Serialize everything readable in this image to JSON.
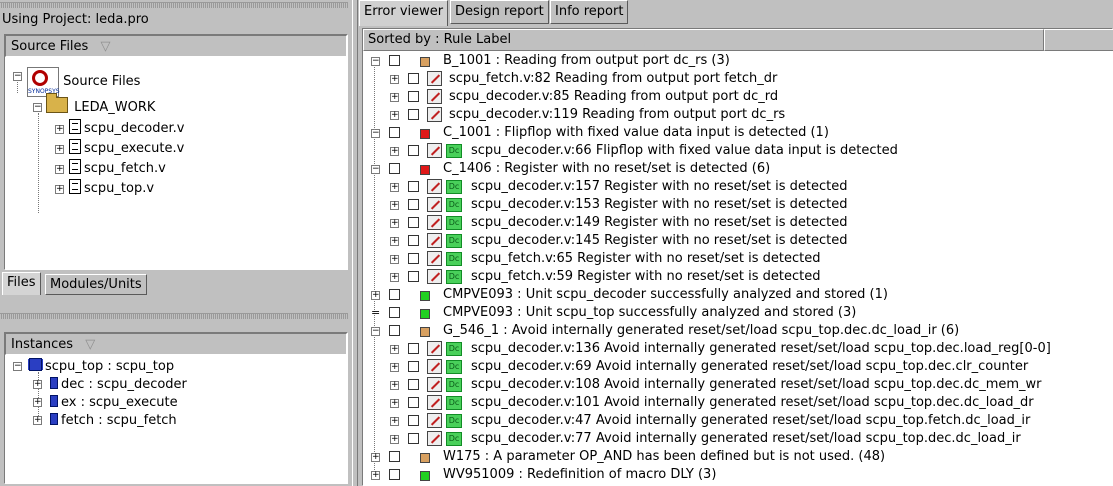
{
  "left": {
    "project_label": "Using Project: leda.pro",
    "source_panel": {
      "header": "Source Files",
      "root": "Source Files",
      "folder": "LEDA_WORK",
      "files": [
        "scpu_decoder.v",
        "scpu_execute.v",
        "scpu_fetch.v",
        "scpu_top.v"
      ]
    },
    "tabs": {
      "files": "Files",
      "modules": "Modules/Units"
    },
    "instances_panel": {
      "header": "Instances",
      "root": "scpu_top : scpu_top",
      "children": [
        "dec : scpu_decoder",
        "ex : scpu_execute",
        "fetch : scpu_fetch"
      ]
    }
  },
  "right": {
    "tabs": [
      "Error viewer",
      "Design report",
      "Info report"
    ],
    "sort_label": "Sorted by : Rule Label",
    "colors": {
      "orange": "#d8a060",
      "red": "#e01818",
      "green": "#20d020"
    },
    "rows": [
      {
        "level": 0,
        "sev": "orange",
        "text": "B_1001 : Reading from output port dc_rs (3)",
        "exp": "-"
      },
      {
        "level": 1,
        "icon": "pencil",
        "text": "scpu_fetch.v:82 Reading from output port fetch_dr",
        "exp": "+"
      },
      {
        "level": 1,
        "icon": "pencil",
        "text": "scpu_decoder.v:85 Reading from output port dc_rd",
        "exp": "+"
      },
      {
        "level": 1,
        "icon": "pencil",
        "text": "scpu_decoder.v:119 Reading from output port dc_rs",
        "exp": "+"
      },
      {
        "level": 0,
        "sev": "red",
        "text": "C_1001 : Flipflop with fixed value data input is detected (1)",
        "exp": "-"
      },
      {
        "level": 1,
        "icon": "pencil-dc",
        "text": "scpu_decoder.v:66 Flipflop with fixed value data input is detected",
        "exp": "+"
      },
      {
        "level": 0,
        "sev": "red",
        "text": "C_1406 : Register with no reset/set is detected (6)",
        "exp": "-"
      },
      {
        "level": 1,
        "icon": "pencil-dc",
        "text": "scpu_decoder.v:157 Register with no reset/set is detected",
        "exp": "+"
      },
      {
        "level": 1,
        "icon": "pencil-dc",
        "text": "scpu_decoder.v:153 Register with no reset/set is detected",
        "exp": "+"
      },
      {
        "level": 1,
        "icon": "pencil-dc",
        "text": "scpu_decoder.v:149 Register with no reset/set is detected",
        "exp": "+"
      },
      {
        "level": 1,
        "icon": "pencil-dc",
        "text": "scpu_decoder.v:145 Register with no reset/set is detected",
        "exp": "+"
      },
      {
        "level": 1,
        "icon": "pencil-dc",
        "text": "scpu_fetch.v:65 Register with no reset/set is detected",
        "exp": "+"
      },
      {
        "level": 1,
        "icon": "pencil-dc",
        "text": "scpu_fetch.v:59 Register with no reset/set is detected",
        "exp": "+"
      },
      {
        "level": 0,
        "sev": "green",
        "text": "CMPVE093 : Unit scpu_decoder successfully analyzed and stored (1)",
        "exp": "+"
      },
      {
        "level": 0,
        "sev": "green",
        "text": "CMPVE093 : Unit scpu_top successfully analyzed and stored (3)",
        "exp": "="
      },
      {
        "level": 0,
        "sev": "orange",
        "text": "G_546_1 : Avoid internally generated reset/set/load scpu_top.dec.dc_load_ir (6)",
        "exp": "-"
      },
      {
        "level": 1,
        "icon": "pencil-dc",
        "text": "scpu_decoder.v:136 Avoid internally generated reset/set/load scpu_top.dec.load_reg[0-0]",
        "exp": "+"
      },
      {
        "level": 1,
        "icon": "pencil-dc",
        "text": "scpu_decoder.v:69 Avoid internally generated reset/set/load scpu_top.dec.clr_counter",
        "exp": "+"
      },
      {
        "level": 1,
        "icon": "pencil-dc",
        "text": "scpu_decoder.v:108 Avoid internally generated reset/set/load scpu_top.dec.dc_mem_wr",
        "exp": "+"
      },
      {
        "level": 1,
        "icon": "pencil-dc",
        "text": "scpu_decoder.v:101 Avoid internally generated reset/set/load scpu_top.dec.dc_load_dr",
        "exp": "+"
      },
      {
        "level": 1,
        "icon": "pencil-dc",
        "text": "scpu_decoder.v:47 Avoid internally generated reset/set/load scpu_top.fetch.dc_load_ir",
        "exp": "+"
      },
      {
        "level": 1,
        "icon": "pencil-dc",
        "text": "scpu_decoder.v:77 Avoid internally generated reset/set/load scpu_top.dec.dc_load_ir",
        "exp": "+"
      },
      {
        "level": 0,
        "sev": "orange",
        "text": "W175 : A parameter OP_AND has been defined but is not used. (48)",
        "exp": "+"
      },
      {
        "level": 0,
        "sev": "green",
        "text": "WV951009 : Redefinition of macro DLY (3)",
        "exp": "+"
      }
    ]
  }
}
